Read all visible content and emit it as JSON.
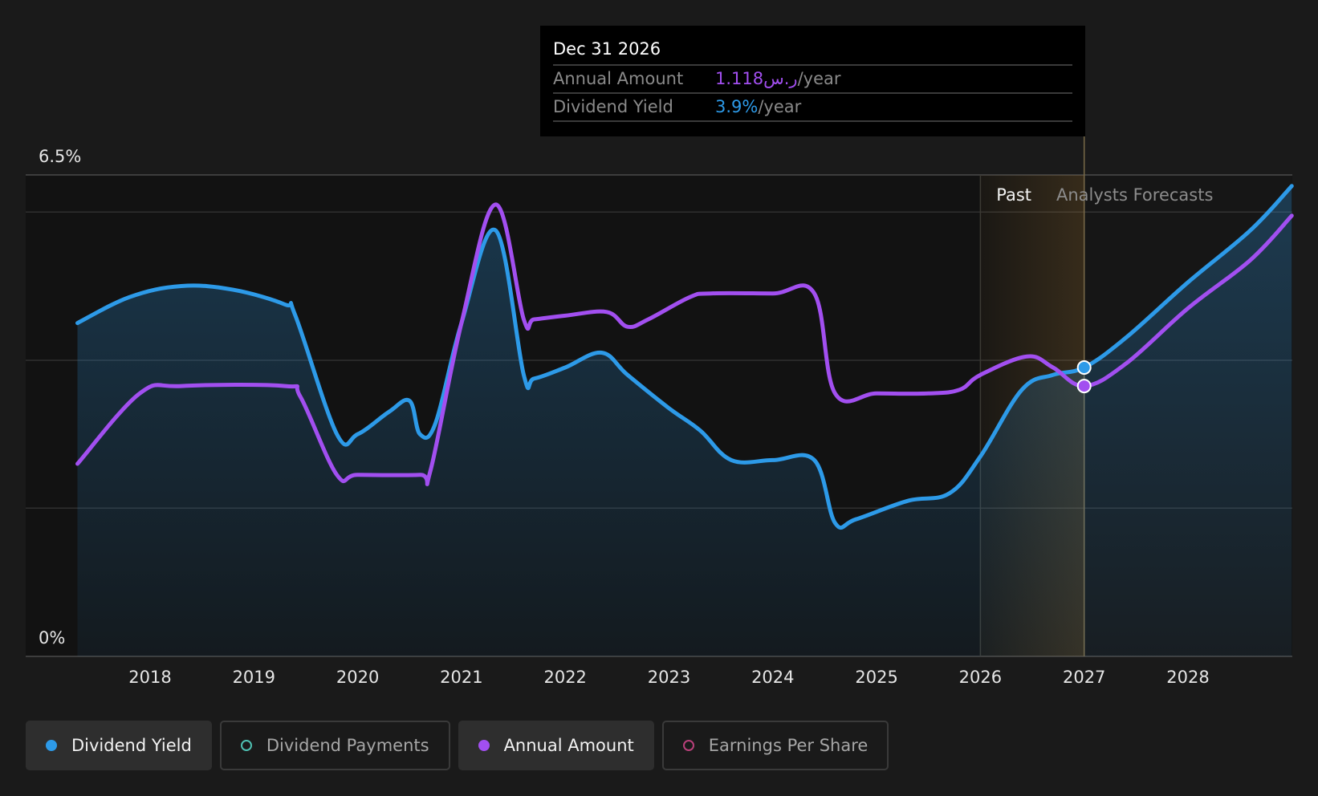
{
  "chart_data": {
    "type": "line",
    "y_axis": {
      "top_label": "6.5%",
      "bottom_label": "0%",
      "ylim": [
        0,
        6.5
      ]
    },
    "x_axis": {
      "tick_labels": [
        "2018",
        "2019",
        "2020",
        "2021",
        "2022",
        "2023",
        "2024",
        "2025",
        "2026",
        "2027",
        "2028"
      ],
      "xlim": [
        2017.3,
        2029.0
      ]
    },
    "grid": true,
    "regions": {
      "past_label": "Past",
      "forecast_label": "Analysts Forecasts",
      "past_start": 2026.0,
      "divider": 2027.0
    },
    "series": [
      {
        "name": "Dividend Yield",
        "unit": "%",
        "color": "#2d9ae8",
        "filled": true,
        "points": [
          [
            2017.3,
            4.5
          ],
          [
            2017.8,
            4.85
          ],
          [
            2018.3,
            5.0
          ],
          [
            2018.8,
            4.95
          ],
          [
            2019.3,
            4.75
          ],
          [
            2019.4,
            4.6
          ],
          [
            2019.8,
            3.0
          ],
          [
            2020.0,
            3.0
          ],
          [
            2020.3,
            3.3
          ],
          [
            2020.5,
            3.45
          ],
          [
            2020.6,
            3.0
          ],
          [
            2020.75,
            3.15
          ],
          [
            2021.0,
            4.5
          ],
          [
            2021.33,
            5.75
          ],
          [
            2021.6,
            3.8
          ],
          [
            2021.7,
            3.75
          ],
          [
            2022.0,
            3.9
          ],
          [
            2022.35,
            4.1
          ],
          [
            2022.6,
            3.8
          ],
          [
            2023.0,
            3.35
          ],
          [
            2023.3,
            3.05
          ],
          [
            2023.6,
            2.65
          ],
          [
            2024.0,
            2.65
          ],
          [
            2024.4,
            2.65
          ],
          [
            2024.6,
            1.8
          ],
          [
            2024.8,
            1.85
          ],
          [
            2025.3,
            2.1
          ],
          [
            2025.7,
            2.2
          ],
          [
            2026.0,
            2.7
          ],
          [
            2026.4,
            3.6
          ],
          [
            2026.7,
            3.8
          ],
          [
            2027.0,
            3.9
          ],
          [
            2027.4,
            4.3
          ],
          [
            2028.0,
            5.05
          ],
          [
            2028.6,
            5.75
          ],
          [
            2029.0,
            6.35
          ]
        ]
      },
      {
        "name": "Annual Amount",
        "unit": "ر.س",
        "color": "#a24ff0",
        "filled": false,
        "points": [
          [
            2017.3,
            2.6
          ],
          [
            2017.9,
            3.55
          ],
          [
            2018.3,
            3.65
          ],
          [
            2019.3,
            3.65
          ],
          [
            2019.45,
            3.5
          ],
          [
            2019.8,
            2.45
          ],
          [
            2020.0,
            2.45
          ],
          [
            2020.6,
            2.45
          ],
          [
            2020.7,
            2.5
          ],
          [
            2021.0,
            4.5
          ],
          [
            2021.33,
            6.1
          ],
          [
            2021.6,
            4.55
          ],
          [
            2021.7,
            4.55
          ],
          [
            2022.0,
            4.6
          ],
          [
            2022.4,
            4.65
          ],
          [
            2022.6,
            4.45
          ],
          [
            2022.8,
            4.55
          ],
          [
            2023.2,
            4.85
          ],
          [
            2023.4,
            4.9
          ],
          [
            2024.0,
            4.9
          ],
          [
            2024.4,
            4.9
          ],
          [
            2024.6,
            3.55
          ],
          [
            2025.0,
            3.55
          ],
          [
            2025.5,
            3.55
          ],
          [
            2025.8,
            3.6
          ],
          [
            2026.0,
            3.8
          ],
          [
            2026.45,
            4.05
          ],
          [
            2026.7,
            3.9
          ],
          [
            2027.0,
            3.65
          ],
          [
            2027.4,
            3.95
          ],
          [
            2028.0,
            4.7
          ],
          [
            2028.6,
            5.35
          ],
          [
            2029.0,
            5.95
          ]
        ]
      }
    ],
    "highlight_points": [
      {
        "series": "Dividend Yield",
        "x": 2027.0,
        "y": 3.9
      },
      {
        "series": "Annual Amount",
        "x": 2027.0,
        "y": 3.65
      }
    ]
  },
  "tooltip": {
    "date": "Dec 31 2026",
    "rows": [
      {
        "label": "Annual Amount",
        "value": "1.118ر.س",
        "unit": "/year"
      },
      {
        "label": "Dividend Yield",
        "value": "3.9%",
        "unit": "/year"
      }
    ]
  },
  "legend": [
    {
      "label": "Dividend Yield",
      "color": "#2d9ae8",
      "active": true,
      "hollow": false
    },
    {
      "label": "Dividend Payments",
      "color": "#4fc1b2",
      "active": false,
      "hollow": true
    },
    {
      "label": "Annual Amount",
      "color": "#a24ff0",
      "active": true,
      "hollow": false
    },
    {
      "label": "Earnings Per Share",
      "color": "#b8407a",
      "active": false,
      "hollow": true
    }
  ]
}
